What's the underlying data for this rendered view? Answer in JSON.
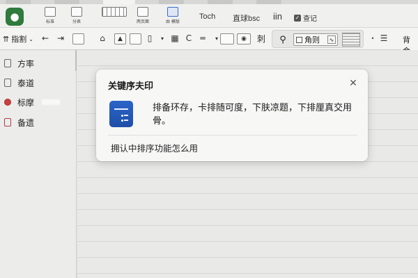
{
  "ribbon": {
    "row1": {
      "btn_a_label": "标准",
      "btn_b_label": "分表",
      "btn_c_label": "两页面",
      "btn_d_label": "由 模版",
      "text_1": "Toch",
      "text_2": "直球bsc",
      "text_3": "iin",
      "check_label": "查记"
    },
    "row2": {
      "left_label": "指割",
      "view_label": "角则",
      "right_label": "背金"
    }
  },
  "sidebar": {
    "items": [
      {
        "label": "方率"
      },
      {
        "label": "泰道"
      },
      {
        "label": "标摩"
      },
      {
        "label": "备遗"
      }
    ]
  },
  "popup": {
    "title": "关键序夫印",
    "message": "排备环存，卡排随可度，下肤凉题，下排厘真交用骨。",
    "link": "拥认中排序功能怎么用",
    "close_glyph": "✕"
  },
  "colors": {
    "app_logo": "#2f7a3c",
    "popup_icon": "#2a64c8",
    "background": "#e9e9e7"
  }
}
